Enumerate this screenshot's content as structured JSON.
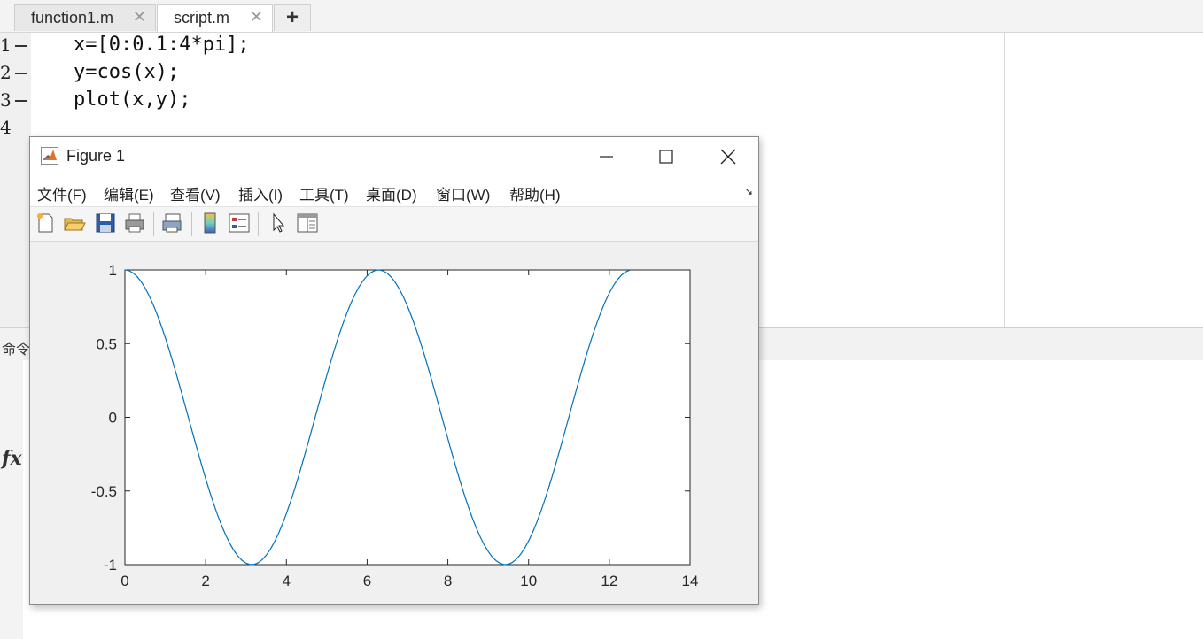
{
  "tabs": [
    {
      "label": "function1.m",
      "active": false
    },
    {
      "label": "script.m",
      "active": true
    }
  ],
  "tab_close_glyph": "✕",
  "tab_add_glyph": "+",
  "editor": {
    "lines": [
      {
        "num": "1",
        "code": "x=[0:0.1:4*pi];"
      },
      {
        "num": "2",
        "code": "y=cos(x);"
      },
      {
        "num": "3",
        "code": "plot(x,y);"
      },
      {
        "num": "4",
        "code": ""
      }
    ]
  },
  "command_window": {
    "label": "命令",
    "prompt_icon": "fx"
  },
  "figure": {
    "title": "Figure 1",
    "menu": [
      "文件(F)",
      "编辑(E)",
      "查看(V)",
      "插入(I)",
      "工具(T)",
      "桌面(D)",
      "窗口(W)",
      "帮助(H)"
    ],
    "corner_glyph": "↘",
    "toolbar_icons": [
      "new-figure-icon",
      "open-file-icon",
      "save-icon",
      "print-icon",
      "print-preview-icon",
      "colorbar-icon",
      "legend-icon",
      "pointer-icon",
      "property-editor-icon"
    ]
  },
  "colors": {
    "line": "#0072BD"
  },
  "chart_data": {
    "type": "line",
    "title": "",
    "xlabel": "",
    "ylabel": "",
    "xlim": [
      0,
      14
    ],
    "ylim": [
      -1,
      1
    ],
    "xticks": [
      "0",
      "2",
      "4",
      "6",
      "8",
      "10",
      "12",
      "14"
    ],
    "yticks": [
      "1",
      "0.5",
      "0",
      "-0.5",
      "-1"
    ],
    "grid": false,
    "series": [
      {
        "function": "y=cos(x)",
        "x_start": 0,
        "x_step": 0.1,
        "x_end": 12.5664
      }
    ]
  }
}
